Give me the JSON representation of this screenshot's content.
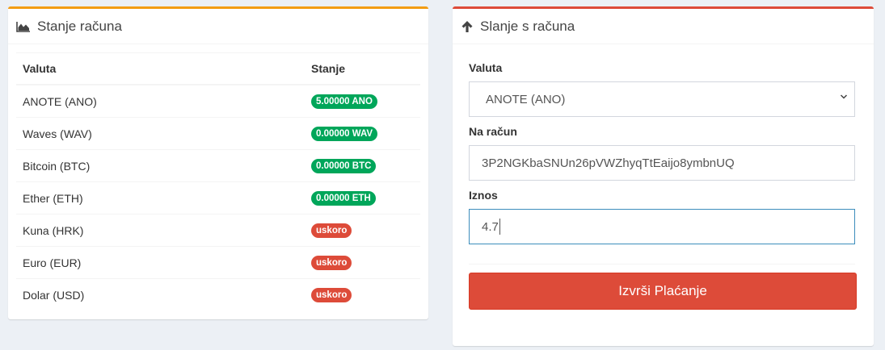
{
  "balance_panel": {
    "title": "Stanje računa",
    "icon": "area-chart-icon",
    "accent": "#f39c12",
    "columns": [
      "Valuta",
      "Stanje"
    ],
    "rows": [
      {
        "currency": "ANOTE (ANO)",
        "balance": "5.00000 ANO",
        "status_color": "#00a65a"
      },
      {
        "currency": "Waves (WAV)",
        "balance": "0.00000 WAV",
        "status_color": "#00a65a"
      },
      {
        "currency": "Bitcoin (BTC)",
        "balance": "0.00000 BTC",
        "status_color": "#00a65a"
      },
      {
        "currency": "Ether (ETH)",
        "balance": "0.00000 ETH",
        "status_color": "#00a65a"
      },
      {
        "currency": "Kuna (HRK)",
        "balance": "uskoro",
        "status_color": "#dd4b39"
      },
      {
        "currency": "Euro (EUR)",
        "balance": "uskoro",
        "status_color": "#dd4b39"
      },
      {
        "currency": "Dolar (USD)",
        "balance": "uskoro",
        "status_color": "#dd4b39"
      }
    ]
  },
  "send_panel": {
    "title": "Slanje s računa",
    "icon": "arrow-up-icon",
    "accent": "#dd4b39",
    "currency_label": "Valuta",
    "currency_value": "ANOTE (ANO)",
    "account_label": "Na račun",
    "account_value": "3P2NGKbaSNUn26pVWZhyqTtEaijo8ymbnUQ",
    "amount_label": "Iznos",
    "amount_value": "4.7",
    "submit_label": "Izvrši Plaćanje"
  }
}
